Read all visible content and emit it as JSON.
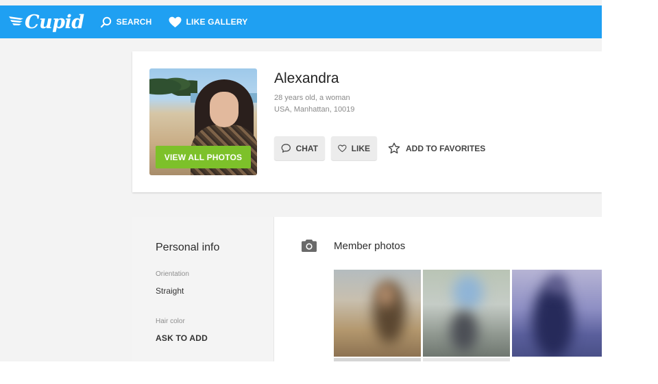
{
  "header": {
    "logo_text": "Cupid",
    "nav": [
      {
        "label": "SEARCH",
        "icon": "search-icon"
      },
      {
        "label": "LIKE GALLERY",
        "icon": "heart-icon"
      }
    ],
    "brand_color": "#1fa0f2"
  },
  "profile": {
    "name": "Alexandra",
    "age_gender": "28 years old, a woman",
    "location": "USA, Manhattan, 10019",
    "view_photos_label": "VIEW ALL PHOTOS",
    "view_photos_color": "#7dc12a",
    "actions": {
      "chat": "CHAT",
      "like": "LIKE",
      "favorites": "ADD TO FAVORITES"
    }
  },
  "personal_info": {
    "title": "Personal info",
    "fields": [
      {
        "label": "Orientation",
        "value": "Straight"
      },
      {
        "label": "Hair color",
        "value": "ASK TO ADD"
      }
    ]
  },
  "member_photos": {
    "title": "Member photos",
    "icon": "camera-icon"
  }
}
